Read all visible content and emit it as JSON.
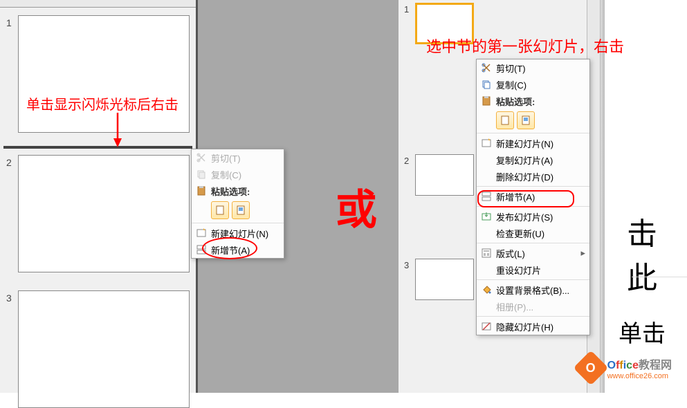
{
  "left": {
    "slides": [
      "1",
      "2",
      "3"
    ],
    "annotation": "单击显示闪烁光标后右击",
    "menu": {
      "cut": "剪切(T)",
      "copy": "复制(C)",
      "paste_opts": "粘贴选项:",
      "new_slide": "新建幻灯片(N)",
      "add_section": "新增节(A)"
    }
  },
  "center": {
    "or": "或"
  },
  "right": {
    "slides": [
      "1",
      "2",
      "3"
    ],
    "annotation": "选中节的第一张幻灯片，右击",
    "menu": {
      "cut": "剪切(T)",
      "copy": "复制(C)",
      "paste_opts": "粘贴选项:",
      "new_slide": "新建幻灯片(N)",
      "dup_slide": "复制幻灯片(A)",
      "del_slide": "删除幻灯片(D)",
      "add_section": "新增节(A)",
      "publish": "发布幻灯片(S)",
      "check_update": "检查更新(U)",
      "layout": "版式(L)",
      "reset": "重设幻灯片",
      "bg_format": "设置背景格式(B)...",
      "album": "相册(P)...",
      "hide": "隐藏幻灯片(H)"
    },
    "edit_text1": "击此",
    "edit_text2": "单击"
  },
  "watermark": {
    "brand": "Office",
    "suffix": "教程网",
    "url": "www.office26.com"
  }
}
